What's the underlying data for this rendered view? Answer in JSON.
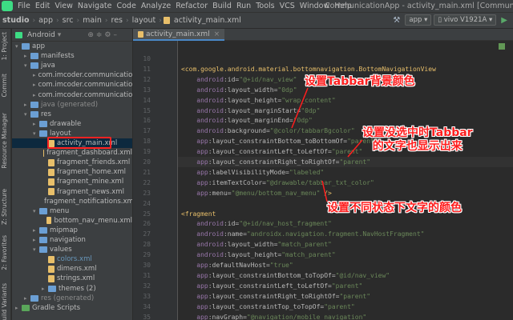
{
  "menubar": {
    "items": [
      "File",
      "Edit",
      "View",
      "Navigate",
      "Code",
      "Analyze",
      "Refactor",
      "Build",
      "Run",
      "Tools",
      "VCS",
      "Window",
      "Help"
    ],
    "window_title": "CommunicationApp - activity_main.xml [CommunicationApp.app] - Ar"
  },
  "toolbar": {
    "breadcrumbs": [
      "studio",
      "app",
      "src",
      "main",
      "res",
      "layout",
      "activity_main.xml"
    ],
    "run_config": "app",
    "device": "vivo V1921A"
  },
  "side_strip": {
    "tabs": [
      "1: Project",
      "Commit",
      "Resource Manager",
      "Z: Structure",
      "2: Favorites",
      "Build Variants"
    ]
  },
  "project": {
    "view_label": "Android",
    "tree": [
      {
        "label": "app",
        "depth": 0,
        "kind": "module",
        "open": true
      },
      {
        "label": "manifests",
        "depth": 1,
        "kind": "folder",
        "open": false
      },
      {
        "label": "java",
        "depth": 1,
        "kind": "folder",
        "open": true
      },
      {
        "label": "com.imcoder.communicationap",
        "depth": 2,
        "kind": "pkg",
        "open": false
      },
      {
        "label": "com.imcoder.communicationap",
        "depth": 2,
        "kind": "pkg",
        "open": false
      },
      {
        "label": "com.imcoder.communicationap",
        "depth": 2,
        "kind": "pkg",
        "open": false
      },
      {
        "label": "java (generated)",
        "depth": 1,
        "kind": "folder",
        "open": false
      },
      {
        "label": "res",
        "depth": 1,
        "kind": "folder",
        "open": true
      },
      {
        "label": "drawable",
        "depth": 2,
        "kind": "folder",
        "open": false
      },
      {
        "label": "layout",
        "depth": 2,
        "kind": "folder",
        "open": true
      },
      {
        "label": "activity_main.xml",
        "depth": 3,
        "kind": "file",
        "selected": true
      },
      {
        "label": "fragment_dashboard.xml",
        "depth": 3,
        "kind": "file"
      },
      {
        "label": "fragment_friends.xml",
        "depth": 3,
        "kind": "file"
      },
      {
        "label": "fragment_home.xml",
        "depth": 3,
        "kind": "file"
      },
      {
        "label": "fragment_mine.xml",
        "depth": 3,
        "kind": "file"
      },
      {
        "label": "fragment_news.xml",
        "depth": 3,
        "kind": "file"
      },
      {
        "label": "fragment_notifications.xml",
        "depth": 3,
        "kind": "file"
      },
      {
        "label": "menu",
        "depth": 2,
        "kind": "folder",
        "open": true
      },
      {
        "label": "bottom_nav_menu.xml",
        "depth": 3,
        "kind": "file"
      },
      {
        "label": "mipmap",
        "depth": 2,
        "kind": "folder",
        "open": false
      },
      {
        "label": "navigation",
        "depth": 2,
        "kind": "folder",
        "open": false
      },
      {
        "label": "values",
        "depth": 2,
        "kind": "folder",
        "open": true
      },
      {
        "label": "colors.xml",
        "depth": 3,
        "kind": "file",
        "blue": true
      },
      {
        "label": "dimens.xml",
        "depth": 3,
        "kind": "file"
      },
      {
        "label": "strings.xml",
        "depth": 3,
        "kind": "file"
      },
      {
        "label": "themes (2)",
        "depth": 3,
        "kind": "folder",
        "open": false
      },
      {
        "label": "res (generated)",
        "depth": 1,
        "kind": "folder",
        "open": false
      },
      {
        "label": "Gradle Scripts",
        "depth": 0,
        "kind": "gradle",
        "open": false
      }
    ]
  },
  "editor": {
    "tab_label": "activity_main.xml",
    "line_numbers": [
      "10",
      "11",
      "12",
      "13",
      "14",
      "15",
      "16",
      "17",
      "18",
      "19",
      "20",
      "21",
      "22",
      "23",
      "24",
      "25",
      "26",
      "27",
      "28",
      "29",
      "30",
      "31",
      "32",
      "33",
      "34",
      "35",
      "36"
    ],
    "current_line": "20",
    "lines": [
      [],
      [
        {
          "t": "<com.google.android.material.bottomnavigation.BottomNavigationView",
          "c": "tg"
        }
      ],
      [
        {
          "t": "    android",
          "c": "ns"
        },
        {
          "t": ":id=",
          "c": "at"
        },
        {
          "t": "\"@+id/nav_view\"",
          "c": "st"
        }
      ],
      [
        {
          "t": "    android",
          "c": "ns"
        },
        {
          "t": ":layout_width=",
          "c": "at"
        },
        {
          "t": "\"0dp\"",
          "c": "st"
        }
      ],
      [
        {
          "t": "    android",
          "c": "ns"
        },
        {
          "t": ":layout_height=",
          "c": "at"
        },
        {
          "t": "\"wrap_content\"",
          "c": "st"
        }
      ],
      [
        {
          "t": "    android",
          "c": "ns"
        },
        {
          "t": ":layout_marginStart=",
          "c": "at"
        },
        {
          "t": "\"0dp\"",
          "c": "st"
        }
      ],
      [
        {
          "t": "    android",
          "c": "ns"
        },
        {
          "t": ":layout_marginEnd=",
          "c": "at"
        },
        {
          "t": "\"0dp\"",
          "c": "st"
        }
      ],
      [
        {
          "t": "    android",
          "c": "ns"
        },
        {
          "t": ":background=",
          "c": "at"
        },
        {
          "t": "\"@color/tabbarBgcolor\"",
          "c": "st"
        }
      ],
      [
        {
          "t": "    app",
          "c": "ns"
        },
        {
          "t": ":layout_constraintBottom_toBottomOf=",
          "c": "at"
        },
        {
          "t": "\"parent\"",
          "c": "st"
        }
      ],
      [
        {
          "t": "    app",
          "c": "ns"
        },
        {
          "t": ":layout_constraintLeft_toLeftOf=",
          "c": "at"
        },
        {
          "t": "\"parent\"",
          "c": "st"
        }
      ],
      [
        {
          "t": "    app",
          "c": "ns"
        },
        {
          "t": ":layout_constraintRight_toRightOf=",
          "c": "at"
        },
        {
          "t": "\"parent\"",
          "c": "st"
        }
      ],
      [
        {
          "t": "    app",
          "c": "ns"
        },
        {
          "t": ":labelVisibilityMode=",
          "c": "at"
        },
        {
          "t": "\"labeled\"",
          "c": "st"
        }
      ],
      [
        {
          "t": "    app",
          "c": "ns"
        },
        {
          "t": ":itemTextColor=",
          "c": "at"
        },
        {
          "t": "\"@drawable/tabbar_txt_color\"",
          "c": "st"
        }
      ],
      [
        {
          "t": "    app",
          "c": "ns"
        },
        {
          "t": ":menu=",
          "c": "at"
        },
        {
          "t": "\"@menu/bottom_nav_menu\"",
          "c": "st"
        },
        {
          "t": " />",
          "c": "tg"
        }
      ],
      [],
      [
        {
          "t": "<fragment",
          "c": "tg"
        }
      ],
      [
        {
          "t": "    android",
          "c": "ns"
        },
        {
          "t": ":id=",
          "c": "at"
        },
        {
          "t": "\"@+id/nav_host_fragment\"",
          "c": "st"
        }
      ],
      [
        {
          "t": "    android",
          "c": "ns"
        },
        {
          "t": ":name=",
          "c": "at"
        },
        {
          "t": "\"androidx.navigation.fragment.NavHostFragment\"",
          "c": "st"
        }
      ],
      [
        {
          "t": "    android",
          "c": "ns"
        },
        {
          "t": ":layout_width=",
          "c": "at"
        },
        {
          "t": "\"match_parent\"",
          "c": "st"
        }
      ],
      [
        {
          "t": "    android",
          "c": "ns"
        },
        {
          "t": ":layout_height=",
          "c": "at"
        },
        {
          "t": "\"match_parent\"",
          "c": "st"
        }
      ],
      [
        {
          "t": "    app",
          "c": "ns"
        },
        {
          "t": ":defaultNavHost=",
          "c": "at"
        },
        {
          "t": "\"true\"",
          "c": "st"
        }
      ],
      [
        {
          "t": "    app",
          "c": "ns"
        },
        {
          "t": ":layout_constraintBottom_toTopOf=",
          "c": "at"
        },
        {
          "t": "\"@id/nav_view\"",
          "c": "st"
        }
      ],
      [
        {
          "t": "    app",
          "c": "ns"
        },
        {
          "t": ":layout_constraintLeft_toLeftOf=",
          "c": "at"
        },
        {
          "t": "\"parent\"",
          "c": "st"
        }
      ],
      [
        {
          "t": "    app",
          "c": "ns"
        },
        {
          "t": ":layout_constraintRight_toRightOf=",
          "c": "at"
        },
        {
          "t": "\"parent\"",
          "c": "st"
        }
      ],
      [
        {
          "t": "    app",
          "c": "ns"
        },
        {
          "t": ":layout_constraintTop_toTopOf=",
          "c": "at"
        },
        {
          "t": "\"parent\"",
          "c": "st"
        }
      ],
      [
        {
          "t": "    app",
          "c": "ns"
        },
        {
          "t": ":navGraph=",
          "c": "at"
        },
        {
          "t": "\"@navigation/mobile_navigation\"",
          "c": "st"
        }
      ],
      [
        {
          "t": "    />",
          "c": "tg"
        }
      ]
    ]
  },
  "annotations": {
    "a1": "设置Tabbar背景颜色",
    "a2_line1": "设置没选中时Tabbar",
    "a2_line2": "的文字也显示出来",
    "a3": "设置不同状态下文字的颜色"
  },
  "colors": {
    "accent": "#ff1e1e",
    "selection": "#0d293e",
    "tab_underline": "#4a88c7"
  }
}
